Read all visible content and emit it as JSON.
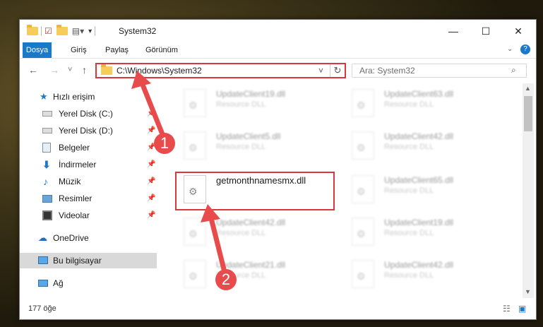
{
  "window": {
    "title": "System32"
  },
  "window_controls": {
    "minimize": "—",
    "maximize": "☐",
    "close": "✕"
  },
  "ribbon": {
    "tabs": [
      "Dosya",
      "Giriş",
      "Paylaş",
      "Görünüm"
    ],
    "accent": "#1979ca"
  },
  "nav": {
    "back": "←",
    "forward": "→",
    "recent": "˅",
    "up": "↑"
  },
  "address": {
    "path": "C:\\Windows\\System32",
    "dropdown": "˅",
    "refresh": "↻"
  },
  "search": {
    "placeholder": "Ara: System32",
    "icon": "search-icon"
  },
  "navpane": {
    "items": [
      {
        "label": "Hızlı erişim",
        "icon": "star-icon"
      },
      {
        "label": "Yerel Disk (C:)",
        "icon": "drive-icon"
      },
      {
        "label": "Yerel Disk (D:)",
        "icon": "drive-icon"
      },
      {
        "label": "Belgeler",
        "icon": "documents-icon"
      },
      {
        "label": "İndirmeler",
        "icon": "download-icon"
      },
      {
        "label": "Müzik",
        "icon": "music-icon"
      },
      {
        "label": "Resimler",
        "icon": "pictures-icon"
      },
      {
        "label": "Videolar",
        "icon": "video-icon"
      },
      {
        "label": "OneDrive",
        "icon": "cloud-icon"
      },
      {
        "label": "Bu bilgisayar",
        "icon": "computer-icon"
      },
      {
        "label": "Ağ",
        "icon": "network-icon"
      }
    ]
  },
  "files": {
    "highlighted": {
      "name": "getmonthnamesmx.dll"
    },
    "items": [
      {
        "name": "UpdateClient19.dll",
        "type": "Resource DLL"
      },
      {
        "name": "UpdateClient63.dll",
        "type": "Resource DLL"
      },
      {
        "name": "UpdateClient5.dll",
        "type": "Resource DLL"
      },
      {
        "name": "UpdateClient42.dll",
        "type": "Resource DLL"
      },
      {
        "name": "UpdateClient65.dll",
        "type": "Resource DLL"
      },
      {
        "name": "UpdateClient42.dll",
        "type": "Resource DLL"
      },
      {
        "name": "UpdateClient19.dll",
        "type": "Resource DLL"
      },
      {
        "name": "UpdateClient21.dll",
        "type": "Resource DLL"
      },
      {
        "name": "UpdateClient42.dll",
        "type": "Resource DLL"
      }
    ]
  },
  "status": {
    "count": "177 öğe"
  },
  "annotations": {
    "badge1": "1",
    "badge2": "2",
    "color": "#e84b4b"
  }
}
